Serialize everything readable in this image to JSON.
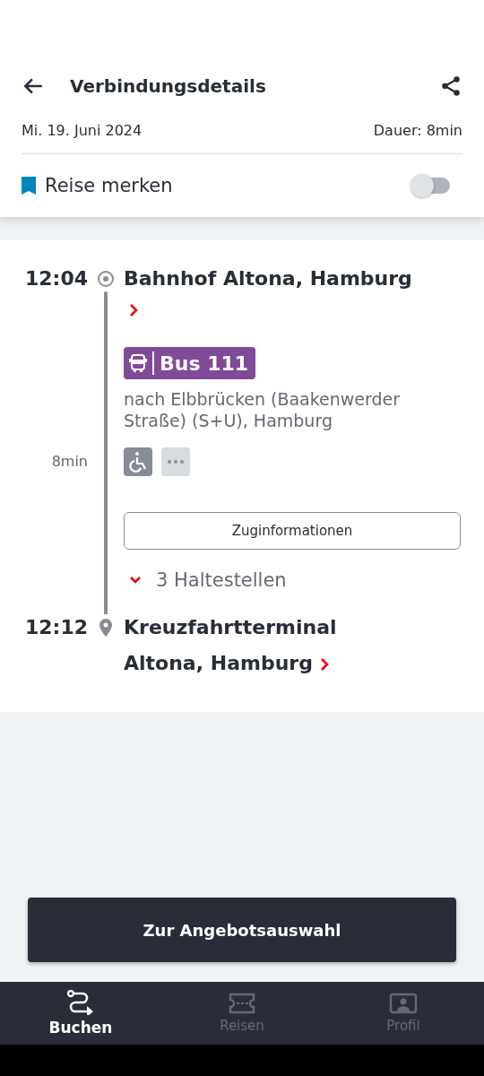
{
  "header": {
    "title": "Verbindungsdetails",
    "date": "Mi. 19. Juni 2024",
    "duration": "Dauer: 8min"
  },
  "save_trip": {
    "label": "Reise merken",
    "on": false
  },
  "journey": {
    "origin": {
      "time": "12:04",
      "station": "Bahnhof Altona, Hamburg"
    },
    "line": {
      "name": "Bus 111",
      "color": "#814a98"
    },
    "direction": "nach Elbbrücken (Baakenwerder Straße) (S+U), Hamburg",
    "travel_time": "8min",
    "info_button": "Zuginformationen",
    "stops": {
      "label": "3 Haltestellen",
      "expanded": false
    },
    "destination": {
      "time": "12:12",
      "station": "Kreuzfahrtterminal Altona, Hamburg"
    }
  },
  "primary_button": "Zur Angebotsauswahl",
  "nav": [
    {
      "label": "Buchen",
      "kind": "route",
      "selected": true
    },
    {
      "label": "Reisen",
      "kind": "ticket",
      "selected": false
    },
    {
      "label": "Profil",
      "kind": "profile",
      "selected": false
    }
  ]
}
